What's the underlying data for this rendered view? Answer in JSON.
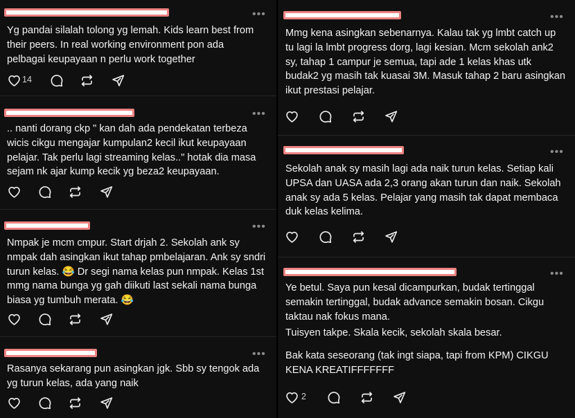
{
  "left_column": {
    "posts": [
      {
        "text": [
          "Yg pandai silalah tolong yg lemah. Kids learn best from their peers. In real working environment pon ada pelbagai keupayaan n perlu work together"
        ],
        "like_count": "14"
      },
      {
        "text": [
          ".. nanti dorang ckp \" kan dah ada pendekatan terbeza wicis cikgu mengajar kumpulan2 kecil ikut keupayaan pelajar. Tak perlu lagi streaming kelas..\" hotak dia masa sejam nk ajar kump kecik yg beza2 keupayaan."
        ],
        "like_count": ""
      },
      {
        "text": [
          "Nmpak je mcm cmpur. Start drjah 2. Sekolah ank sy nmpak dah asingkan ikut tahap pmbelajaran. Ank sy sndri turun kelas. 😂 Dr segi nama kelas pun nmpak. Kelas 1st mmg nama bunga yg gah diikuti last sekali nama bunga biasa yg tumbuh merata. 😂"
        ],
        "like_count": ""
      },
      {
        "text": [
          "Rasanya sekarang pun asingkan jgk. Sbb sy tengok ada yg turun kelas, ada yang naik"
        ],
        "like_count": ""
      }
    ]
  },
  "right_column": {
    "posts": [
      {
        "text": [
          "Mmg kena asingkan sebenarnya. Kalau tak yg lmbt catch up tu lagi la lmbt progress dorg, lagi kesian. Mcm sekolah ank2 sy, tahap 1 campur je semua, tapi ade 1 kelas khas utk budak2 yg masih tak kuasai 3M. Masuk tahap 2 baru asingkan ikut prestasi pelajar."
        ],
        "like_count": ""
      },
      {
        "text": [
          "Sekolah anak sy masih lagi ada naik turun kelas. Setiap kali UPSA dan UASA ada 2,3 orang akan turun dan naik. Sekolah anak sy ada 5 kelas. Pelajar yang masih tak dapat membaca duk kelas kelima."
        ],
        "like_count": ""
      },
      {
        "text": [
          "Ye betul. Saya pun kesal dicampurkan, budak tertinggal semakin tertinggal, budak advance semakin bosan. Cikgu taktau nak fokus mana.",
          "Tuisyen takpe. Skala kecik, sekolah skala besar.",
          "Bak kata seseorang (tak ingt siapa, tapi from KPM) CIKGU KENA KREATIFFFFFFF"
        ],
        "like_count": "2"
      }
    ]
  },
  "icons": [
    "heart-icon",
    "comment-icon",
    "repost-icon",
    "share-icon",
    "more-options-icon"
  ],
  "colors": {
    "background": "#101010",
    "text": "#f3f3f3",
    "redaction_fill": "#ffffff",
    "redaction_border": "#ee8282"
  },
  "ui": {
    "more_glyph": "•••"
  }
}
